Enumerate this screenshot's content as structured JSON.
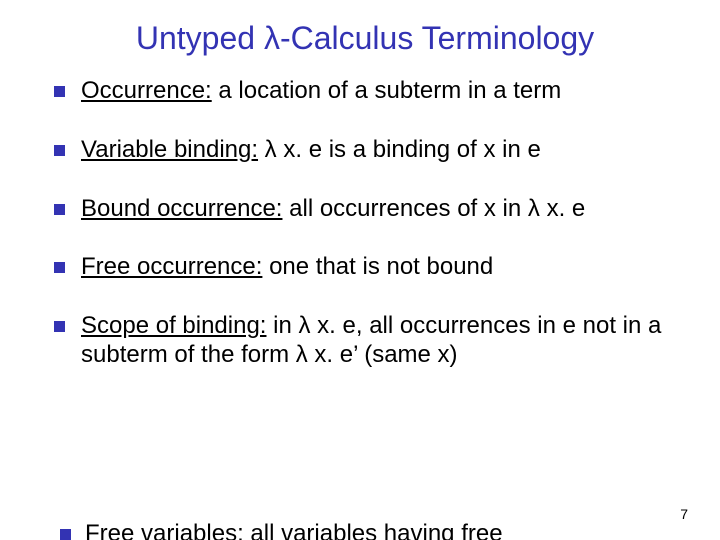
{
  "title": "Untyped λ-Calculus Terminology",
  "items": [
    {
      "term": "Occurrence:",
      "def": " a location of a subterm in a term"
    },
    {
      "term": "Variable binding:",
      "def": " λ x. e is a binding of x in e"
    },
    {
      "term": "Bound occurrence:",
      "def": " all occurrences of x in λ x. e"
    },
    {
      "term": "Free occurrence:",
      "def": " one that is not bound"
    },
    {
      "term": "Scope of binding:",
      "def": " in λ x. e, all occurrences in e not in a subterm of the form λ x. e’ (same x)"
    }
  ],
  "cutoff": {
    "term": "Free variables:",
    "def": " all variables having free"
  },
  "pageNumber": "7"
}
